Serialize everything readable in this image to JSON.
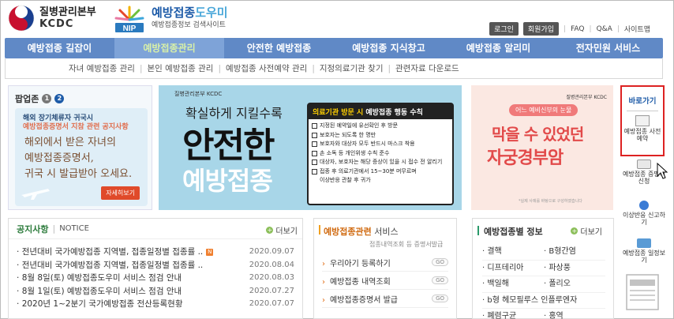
{
  "header": {
    "kdca_name": "질병관리본부",
    "kdca_abbr": "KCDC",
    "site_name_a": "예방접종",
    "site_name_b": "도우미",
    "site_sub": "예방접종정보 검색사이트",
    "nip_label": "NIP"
  },
  "util": {
    "login": "로그인",
    "join": "회원가입",
    "faq": "FAQ",
    "qa": "Q&A",
    "sitemap": "사이트맵"
  },
  "nav": {
    "items": [
      {
        "label": "예방접종 길잡이"
      },
      {
        "label": "예방접종관리"
      },
      {
        "label": "안전한 예방접종"
      },
      {
        "label": "예방접종 지식창고"
      },
      {
        "label": "예방접종 알리미"
      },
      {
        "label": "전자민원 서비스"
      }
    ]
  },
  "subnav": {
    "items": [
      "자녀 예방접종 관리",
      "본인 예방접종 관리",
      "예방접종 사전예약 관리",
      "지정의료기관 찾기",
      "관련자료 다운로드"
    ]
  },
  "popup": {
    "title": "팝업존",
    "n1": "1",
    "n2": "2",
    "line1": "해외 장기체류자 귀국시",
    "line2": "예방접종증명서 지참 관련 공지사항",
    "script1": "해외에서 받은 자녀의",
    "script2": "예방접종증명서,",
    "script3": "귀국 시 발급받아 오세요.",
    "button": "자세히보기"
  },
  "banner_main": {
    "kdca": "질병관리본부 KCDC",
    "line1": "확실하게 지킬수록",
    "line2": "안전한",
    "line3": "예방접종",
    "panel_title_a": "의료기관 방문 시",
    "panel_title_b": "예방접종 행동 수칙",
    "rules": [
      "지정된 예약일에 유선확인 후 방문",
      "보호자는 되도록 한 명만",
      "보호자와 대상자 모두 반드시 마스크 착용",
      "손 소독 등 개인위생 수칙 준수",
      "대상자, 보호자는 해당 증상이 있을 시 접수 전 알리기",
      "접종 후 의료기관에서 15~30분 머무르며",
      "이상반응 관찰 후 귀가"
    ]
  },
  "banner_pink": {
    "kdca": "질병관리본부 KCDC",
    "pill": "어느 예비신부의 눈물",
    "line1": "막을 수 있었던",
    "line2": "자궁경부암",
    "note": "*실제 사례를 바탕으로 구성하였습니다"
  },
  "quick": {
    "title": "바로가기",
    "items": [
      {
        "label": "예방접종 사전예약"
      },
      {
        "label": "예방접종 증명서 신청"
      },
      {
        "label": "이상반응 신고하기"
      },
      {
        "label": "예방접종 일정보기"
      }
    ]
  },
  "notice": {
    "tab1": "공지사항",
    "tab2": "NOTICE",
    "more": "더보기",
    "new_badge": "N",
    "rows": [
      {
        "title": "전년대비 국가예방접종 지역별, 접종일정별 접종률 ..",
        "date": "2020.09.07",
        "new": true
      },
      {
        "title": "전년대비 국가예방접종 지역별, 접종일정별 접종률 ..",
        "date": "2020.08.04",
        "new": false
      },
      {
        "title": "8월 8일(토) 예방접종도우미 서비스 점검 안내",
        "date": "2020.08.03",
        "new": false
      },
      {
        "title": "8월 1일(토) 예방접종도우미 서비스 점검 안내",
        "date": "2020.07.27",
        "new": false
      },
      {
        "title": "2020년 1~2분기 국가예방접종 전산등록현황",
        "date": "2020.07.07",
        "new": false
      }
    ]
  },
  "service": {
    "title_a": "예방접종관련",
    "title_b": "서비스",
    "sub": "접종내역조회 등 증명서발급",
    "go": "GO",
    "items": [
      {
        "label": "우리아기 등록하기"
      },
      {
        "label": "예방접종 내역조회"
      },
      {
        "label": "예방접종증명서 발급"
      }
    ]
  },
  "disease": {
    "title": "예방접종별 정보",
    "more": "더보기",
    "items": [
      "결핵",
      "B형간염",
      "디프테리아",
      "파상풍",
      "백일해",
      "폴리오",
      "b형 헤모필루스 인플루엔자",
      "폐렴구균",
      "홍역"
    ]
  },
  "colors": {
    "nav": "#6089c6",
    "accent_green": "#2a7a3a",
    "accent_orange": "#d06a10",
    "quick_border": "#dd2222"
  }
}
